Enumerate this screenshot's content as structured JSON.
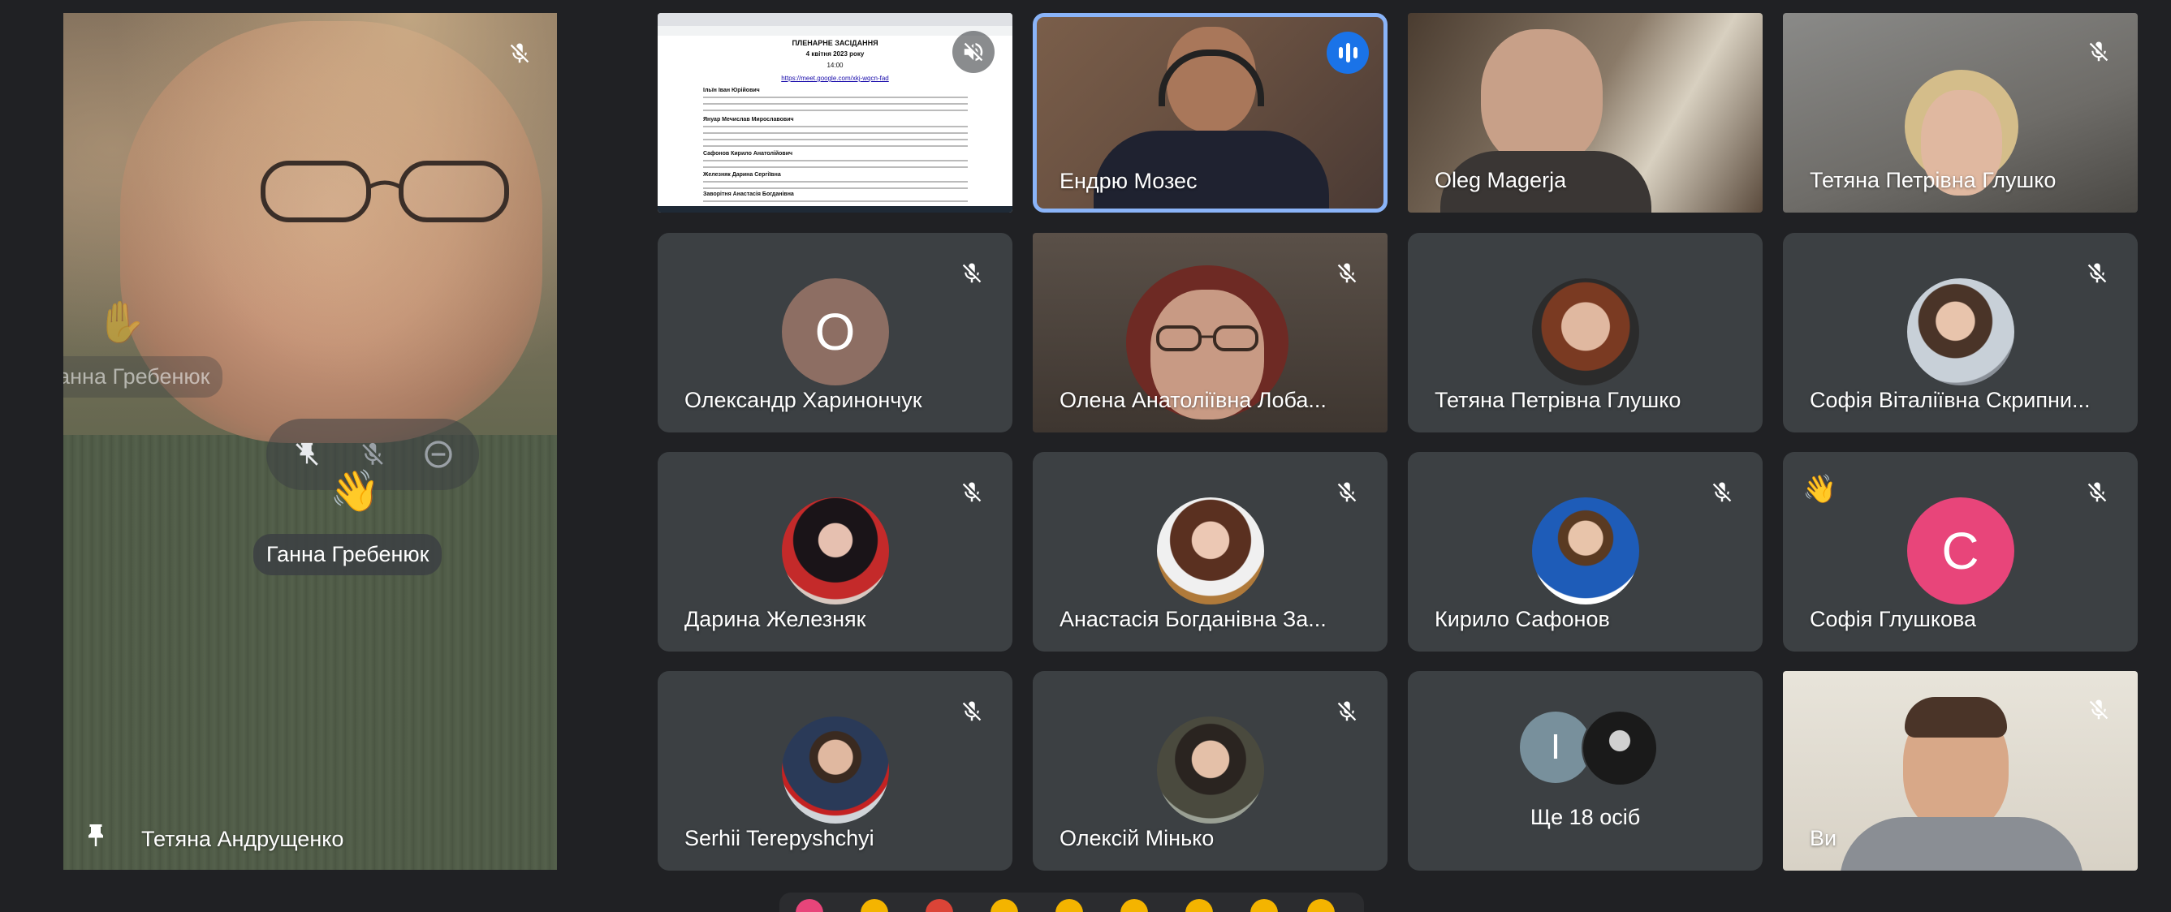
{
  "pinned": {
    "name": "Тетяна Андрущенко",
    "hand_labels": [
      "Ганна Гребенюк",
      "Ганна Гребенюк"
    ]
  },
  "tiles": [
    {
      "id": "screen",
      "name": "",
      "type": "screen",
      "doc_lines": [
        "ПЛЕНАРНЕ ЗАСІДАННЯ",
        "4 квітня 2023 року",
        "14:00",
        "https://meet.google.com/xkj-wqcn-fad",
        "Ільїн Іван Юрійович",
        "Януар Мечислав Мирославович",
        "Сафонов Кирило Анатолійович",
        "Железняк Дарина Сергіївна",
        "Заворітня Анастасія Богданівна"
      ]
    },
    {
      "id": "endrew",
      "name": "Ендрю Мозес",
      "type": "video",
      "speaking": true
    },
    {
      "id": "oleg",
      "name": "Oleg Magerja",
      "type": "video"
    },
    {
      "id": "glushko1",
      "name": "Тетяна Петрівна Глушко",
      "type": "video"
    },
    {
      "id": "kharynonchuk",
      "name": "Олександр Харинончук",
      "type": "letter",
      "letter": "О",
      "color": "#8d6e63"
    },
    {
      "id": "lobanova",
      "name": "Олена Анатоліївна Лоба...",
      "type": "video"
    },
    {
      "id": "glushko2",
      "name": "Тетяна Петрівна Глушко",
      "type": "photo"
    },
    {
      "id": "skrypnyk",
      "name": "Софія Віталіївна Скрипни...",
      "type": "photo"
    },
    {
      "id": "zhelezniak",
      "name": "Дарина Железняк",
      "type": "photo"
    },
    {
      "id": "zavoritnia",
      "name": "Анастасія Богданівна За...",
      "type": "photo"
    },
    {
      "id": "safonov",
      "name": "Кирило Сафонов",
      "type": "photo"
    },
    {
      "id": "hlushkova",
      "name": "Софія Глушкова",
      "type": "letter",
      "letter": "С",
      "color": "#e8457a",
      "hand_raised": true
    },
    {
      "id": "terepyshchyi",
      "name": "Serhii Terepyshchyi",
      "type": "photo"
    },
    {
      "id": "minko",
      "name": "Олексій Мінько",
      "type": "photo"
    },
    {
      "id": "more",
      "name": "Ще 18 осіб",
      "type": "group",
      "letter": "І"
    },
    {
      "id": "me",
      "name": "Ви",
      "type": "video"
    }
  ],
  "colors": {
    "background": "#202124",
    "tile": "#3c4043",
    "speaking_border": "#8ab4f8",
    "speaking_badge": "#1a73e8"
  },
  "icons": [
    "mic-off-icon",
    "pin-icon",
    "hand-raise-icon",
    "remove-icon",
    "audio-wave-icon"
  ]
}
